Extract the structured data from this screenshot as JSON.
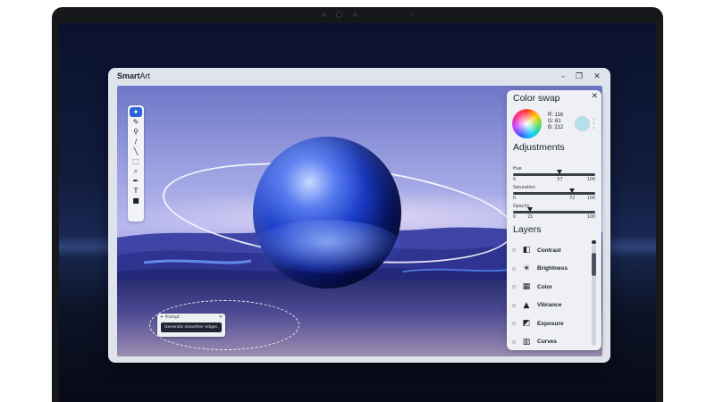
{
  "app": {
    "title_bold": "Smart",
    "title_rest": "Art",
    "controls": {
      "minimize": "–",
      "restore": "❐",
      "close": "✕"
    }
  },
  "toolbar": {
    "tools": [
      {
        "name": "ai-sparkle-tool-icon",
        "glyph": "✦",
        "active": true
      },
      {
        "name": "brush-tool-icon",
        "glyph": "✎"
      },
      {
        "name": "eyedropper-tool-icon",
        "glyph": "⚲"
      },
      {
        "name": "pen-tool-icon",
        "glyph": "/"
      },
      {
        "name": "pencil-tool-icon",
        "glyph": "╲"
      },
      {
        "name": "crop-tool-icon",
        "glyph": "⬚"
      },
      {
        "name": "zoom-tool-icon",
        "glyph": "⌕"
      },
      {
        "name": "marker-tool-icon",
        "glyph": "✒"
      },
      {
        "name": "text-tool-icon",
        "glyph": "T"
      },
      {
        "name": "shape-tool-icon",
        "glyph": "■"
      }
    ]
  },
  "prompt": {
    "title": "Prompt",
    "close": "✕",
    "value": "Generate smoother edges."
  },
  "panel": {
    "close": "✕",
    "color_swap_title": "Color swap",
    "rgb": {
      "r": "R:  116",
      "g": "G:  61",
      "b": "B:  212"
    },
    "swatch_color": "#b3e0ea",
    "adjustments_title": "Adjustments",
    "sliders": [
      {
        "label": "Hue",
        "min": "0",
        "value": "57",
        "max": "100",
        "fraction": 0.57
      },
      {
        "label": "Saturation",
        "min": "0",
        "value": "72",
        "max": "100",
        "fraction": 0.72
      },
      {
        "label": "Opacity",
        "min": "0",
        "value": "21",
        "max": "100",
        "fraction": 0.21
      }
    ],
    "layers_title": "Layers",
    "layers": [
      {
        "label": "Contrast",
        "icon": "contrast-icon",
        "glyph": "◧"
      },
      {
        "label": "Brightness",
        "icon": "brightness-icon",
        "glyph": "☀"
      },
      {
        "label": "Color",
        "icon": "color-grid-icon",
        "glyph": "▦"
      },
      {
        "label": "Vibrance",
        "icon": "vibrance-icon",
        "glyph": "▲"
      },
      {
        "label": "Exposure",
        "icon": "exposure-icon",
        "glyph": "◩"
      },
      {
        "label": "Curves",
        "icon": "curves-icon",
        "glyph": "▥"
      }
    ]
  }
}
